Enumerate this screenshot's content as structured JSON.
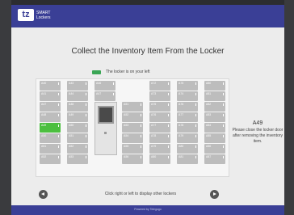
{
  "app": {
    "logo_mark": "tz",
    "logo_text_line1": "SMART",
    "logo_text_line2": "Lockers"
  },
  "page": {
    "title": "Collect the Inventory Item From the Locker"
  },
  "hint": {
    "text": "The locker is on your left"
  },
  "lockers": [
    [
      "A40",
      "A43",
      "A46",
      "—",
      "A72",
      "A75",
      "A80"
    ],
    [
      "A41",
      "A44",
      "A47",
      "—",
      "A73",
      "A74",
      "A81"
    ],
    [
      "A47",
      "A48",
      "—",
      "A51",
      "A75",
      "A76",
      "A82"
    ],
    [
      "A48",
      "A49",
      "—",
      "A52",
      "A76",
      "A77",
      "A83"
    ],
    [
      "A49",
      "A50",
      "—",
      "A53",
      "A77",
      "A78",
      "A84"
    ],
    [
      "A50",
      "A51",
      "—",
      "A54",
      "A78",
      "A79",
      "A85"
    ],
    [
      "A51",
      "A52",
      "—",
      "A55",
      "A79",
      "A80",
      "A86"
    ],
    [
      "A52",
      "A53",
      "—",
      "A56",
      "A80",
      "A81",
      "A87"
    ]
  ],
  "highlight": {
    "locker_id": "A49",
    "color": "#4cbf3f"
  },
  "side": {
    "locker_id": "A49",
    "message": "Please close the locker door after removing the inventory item."
  },
  "navigation": {
    "text": "Click right or left to display other lockers"
  },
  "footer": {
    "text": "Powered by Telegogo"
  },
  "colors": {
    "brand": "#3a3f96",
    "locker": "#bdbdbd",
    "background": "#ececec"
  }
}
